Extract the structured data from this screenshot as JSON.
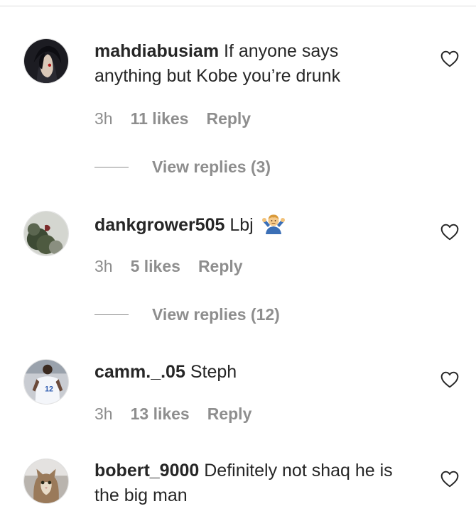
{
  "comments": [
    {
      "username": "mahdiabusiam",
      "text": "If anyone says anything but Kobe you’re drunk",
      "time": "3h",
      "likes": "11 likes",
      "reply": "Reply",
      "view_replies": "View replies (3)"
    },
    {
      "username": "dankgrower505",
      "text": "Lbj",
      "emoji": "person-shrugging-emoji",
      "time": "3h",
      "likes": "5 likes",
      "reply": "Reply",
      "view_replies": "View replies (12)"
    },
    {
      "username": "camm._.05",
      "text": "Steph",
      "time": "3h",
      "likes": "13 likes",
      "reply": "Reply"
    },
    {
      "username": "bobert_9000",
      "text": "Definitely not shaq he is the big man"
    }
  ],
  "icons": {
    "like": "heart-outline-icon"
  },
  "colors": {
    "primary_text": "#262626",
    "secondary_text": "#8e8e8e",
    "divider": "#dbdbdb"
  }
}
